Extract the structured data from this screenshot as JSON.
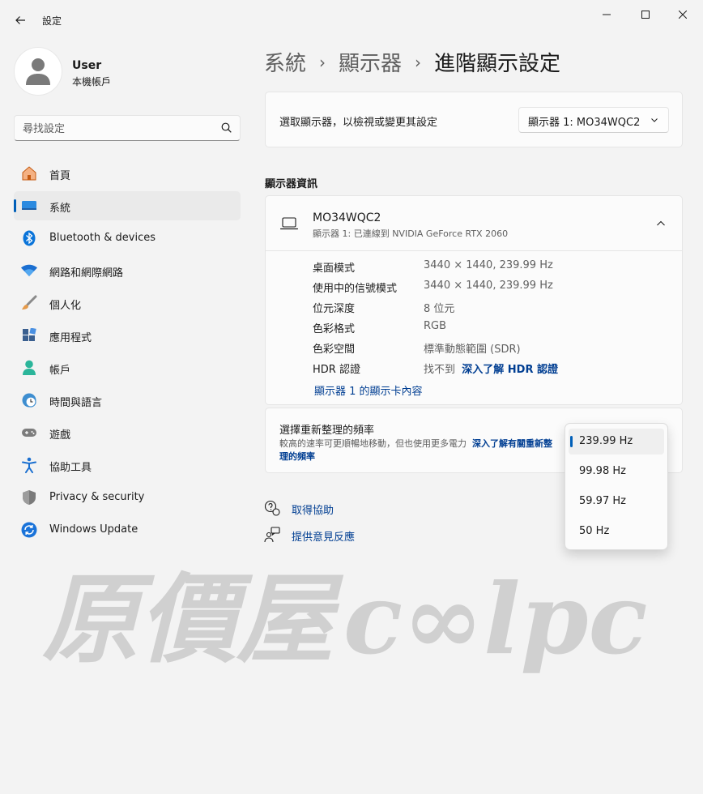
{
  "window": {
    "title": "設定",
    "back_icon": "arrow-left-icon"
  },
  "profile": {
    "name": "User",
    "subtitle": "本機帳戶"
  },
  "search": {
    "placeholder": "尋找設定"
  },
  "nav": {
    "items": [
      {
        "label": "首頁",
        "icon": "home-icon"
      },
      {
        "label": "系統",
        "icon": "system-icon",
        "active": true
      },
      {
        "label": "Bluetooth & devices",
        "icon": "bluetooth-icon"
      },
      {
        "label": "網路和網際網路",
        "icon": "wifi-icon"
      },
      {
        "label": "個人化",
        "icon": "brush-icon"
      },
      {
        "label": "應用程式",
        "icon": "apps-icon"
      },
      {
        "label": "帳戶",
        "icon": "account-icon"
      },
      {
        "label": "時間與語言",
        "icon": "clock-globe-icon"
      },
      {
        "label": "遊戲",
        "icon": "gamepad-icon"
      },
      {
        "label": "協助工具",
        "icon": "accessibility-icon"
      },
      {
        "label": "Privacy & security",
        "icon": "shield-icon"
      },
      {
        "label": "Windows Update",
        "icon": "update-icon"
      }
    ]
  },
  "breadcrumb": {
    "items": [
      "系統",
      "顯示器"
    ],
    "separator": "›",
    "current": "進階顯示設定"
  },
  "display_select": {
    "label": "選取顯示器，以檢視或變更其設定",
    "value": "顯示器 1: MO34WQC2"
  },
  "display_info": {
    "section_title": "顯示器資訊",
    "monitor_name": "MO34WQC2",
    "monitor_sub": "顯示器 1: 已連線到 NVIDIA GeForce RTX 2060",
    "rows": [
      {
        "key": "桌面模式",
        "value": "3440 × 1440, 239.99 Hz"
      },
      {
        "key": "使用中的信號模式",
        "value": "3440 × 1440, 239.99 Hz"
      },
      {
        "key": "位元深度",
        "value": "8 位元"
      },
      {
        "key": "色彩格式",
        "value": "RGB"
      },
      {
        "key": "色彩空間",
        "value": "標準動態範圍 (SDR)"
      }
    ],
    "hdr_key": "HDR 認證",
    "hdr_value": "找不到",
    "hdr_link": "深入了解 HDR 認證",
    "adapter_link": "顯示器 1 的顯示卡內容"
  },
  "refresh_rate": {
    "title": "選擇重新整理的頻率",
    "desc": "較高的速率可更順暢地移動，但也使用更多電力",
    "link": "深入了解有關重新整理的頻率",
    "options": [
      "239.99 Hz",
      "99.98 Hz",
      "59.97 Hz",
      "50 Hz"
    ],
    "selected": "239.99 Hz"
  },
  "help": {
    "get_help": "取得協助",
    "feedback": "提供意見反應"
  },
  "watermark": {
    "text_left": "原價屋",
    "text_right": "c∞lpc"
  },
  "colors": {
    "accent": "#005fb8",
    "link": "#003e92"
  }
}
